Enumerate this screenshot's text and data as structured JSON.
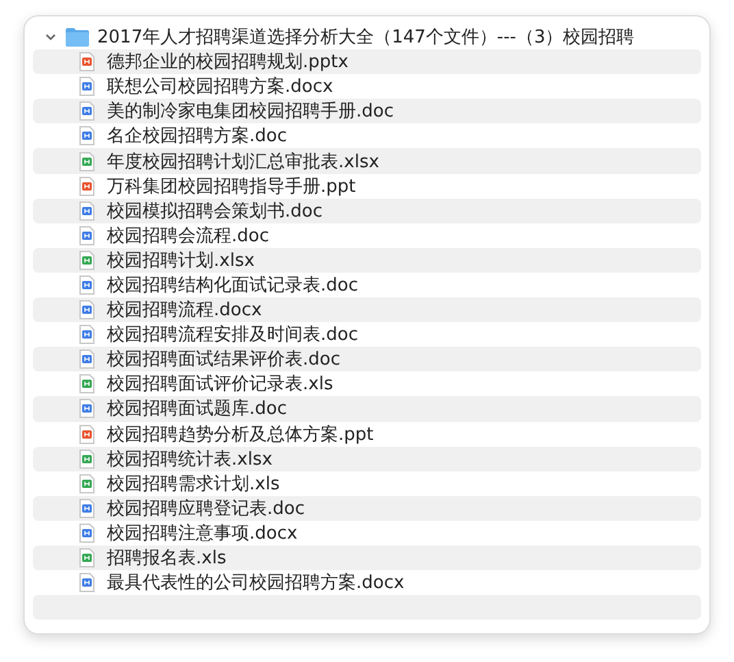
{
  "folder": {
    "name": "2017年人才招聘渠道选择分析大全（147个文件）---（3）校园招聘",
    "expanded": true
  },
  "files": [
    {
      "name": "德邦企业的校园招聘规划.pptx",
      "kind": "presentation"
    },
    {
      "name": "联想公司校园招聘方案.docx",
      "kind": "document"
    },
    {
      "name": "美的制冷家电集团校园招聘手册.doc",
      "kind": "document"
    },
    {
      "name": "名企校园招聘方案.doc",
      "kind": "document"
    },
    {
      "name": "年度校园招聘计划汇总审批表.xlsx",
      "kind": "spreadsheet"
    },
    {
      "name": "万科集团校园招聘指导手册.ppt",
      "kind": "presentation"
    },
    {
      "name": "校园模拟招聘会策划书.doc",
      "kind": "document"
    },
    {
      "name": "校园招聘会流程.doc",
      "kind": "document"
    },
    {
      "name": "校园招聘计划.xlsx",
      "kind": "spreadsheet"
    },
    {
      "name": "校园招聘结构化面试记录表.doc",
      "kind": "document"
    },
    {
      "name": "校园招聘流程.docx",
      "kind": "document"
    },
    {
      "name": "校园招聘流程安排及时间表.doc",
      "kind": "document"
    },
    {
      "name": "校园招聘面试结果评价表.doc",
      "kind": "document"
    },
    {
      "name": "校园招聘面试评价记录表.xls",
      "kind": "spreadsheet"
    },
    {
      "name": "校园招聘面试题库.doc",
      "kind": "document"
    },
    {
      "name": "校园招聘趋势分析及总体方案.ppt",
      "kind": "presentation"
    },
    {
      "name": "校园招聘统计表.xlsx",
      "kind": "spreadsheet"
    },
    {
      "name": "校园招聘需求计划.xls",
      "kind": "spreadsheet"
    },
    {
      "name": "校园招聘应聘登记表.doc",
      "kind": "document"
    },
    {
      "name": "校园招聘注意事项.docx",
      "kind": "document"
    },
    {
      "name": "招聘报名表.xls",
      "kind": "spreadsheet"
    },
    {
      "name": "最具代表性的公司校园招聘方案.docx",
      "kind": "document"
    }
  ]
}
